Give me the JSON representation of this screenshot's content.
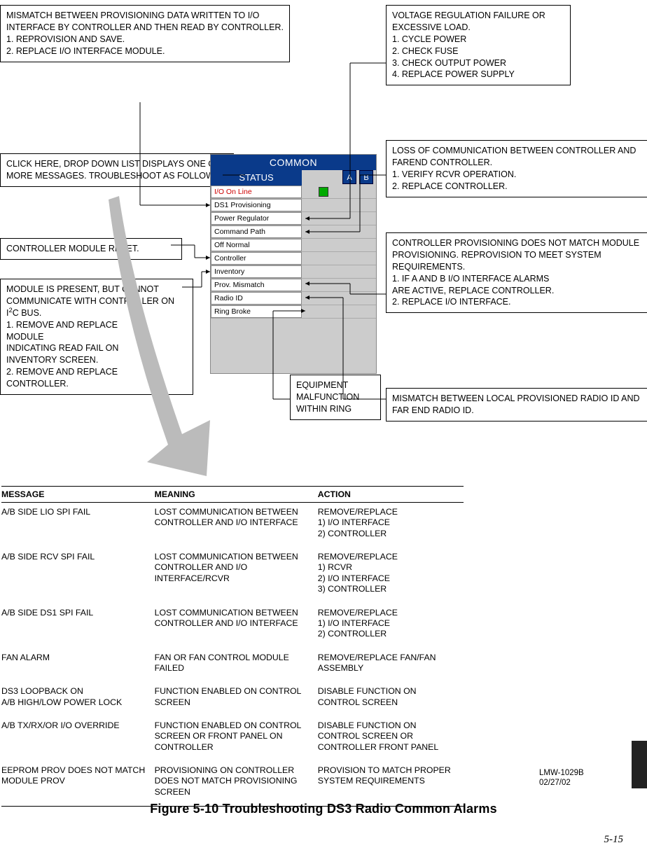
{
  "callouts": {
    "ds1_prov": "MISMATCH BETWEEN PROVISIONING DATA WRITTEN TO I/O INTERFACE BY CONTROLLER AND THEN READ BY CONTROLLER.\n1.  REPROVISION AND SAVE.\n2.  REPLACE I/O INTERFACE MODULE.",
    "voltage": "VOLTAGE REGULATION FAILURE OR EXCESSIVE LOAD.\n1.  CYCLE POWER\n2.  CHECK FUSE\n3.  CHECK OUTPUT POWER\n4.  REPLACE POWER SUPPLY",
    "click_here": "CLICK HERE, DROP DOWN LIST DISPLAYS ONE OR MORE MESSAGES. TROUBLESHOOT AS FOLLOWS.",
    "loss_comm": "LOSS OF COMMUNICATION BETWEEN CONTROLLER AND FAREND CONTROLLER.\n1.  VERIFY RCVR OPERATION.\n2.  REPLACE CONTROLLER.",
    "ctrl_reset": "CONTROLLER MODULE RESET.",
    "prov_mismatch": "CONTROLLER PROVISIONING DOES NOT MATCH MODULE PROVISIONING. REPROVISION TO MEET SYSTEM REQUIREMENTS.\n1.  IF A AND B I/O INTERFACE ALARMS\n     ARE ACTIVE, REPLACE CONTROLLER.\n2.  REPLACE I/O INTERFACE.",
    "module_present_prefix": "MODULE IS PRESENT, BUT CANNOT COMMUNICATE WITH CONTROLLER ON I",
    "module_present_sup": "2",
    "module_present_suffix": "C BUS.\n1.  REMOVE AND REPLACE\n     MODULE\n     INDICATING READ FAIL ON\n     INVENTORY SCREEN.\n2.  REMOVE AND REPLACE\n     CONTROLLER.",
    "ring_broke": "EQUIPMENT MALFUNCTION WITHIN RING",
    "radio_id": "MISMATCH BETWEEN LOCAL PROVISIONED RADIO ID AND FAR END RADIO ID."
  },
  "panel": {
    "common_header": "COMMON",
    "status_label": "STATUS",
    "col_a": "A",
    "col_b": "B",
    "rows": {
      "io_online": "I/O On Line",
      "ds1_prov": "DS1 Provisioning",
      "power_reg": "Power Regulator",
      "cmd_path": "Command Path",
      "off_normal": "Off Normal",
      "controller": "Controller",
      "inventory": "Inventory",
      "prov_mismatch": "Prov. Mismatch",
      "radio_id": "Radio ID",
      "ring_broke": "Ring Broke"
    }
  },
  "table": {
    "headers": {
      "message": "MESSAGE",
      "meaning": "MEANING",
      "action": "ACTION"
    },
    "rows": [
      {
        "message": "A/B SIDE LIO SPI FAIL",
        "meaning": "LOST COMMUNICATION BETWEEN CONTROLLER AND I/O INTERFACE",
        "action": "REMOVE/REPLACE\n1)  I/O INTERFACE\n2)  CONTROLLER"
      },
      {
        "message": "A/B SIDE RCV SPI FAIL",
        "meaning": "LOST COMMUNICATION BETWEEN CONTROLLER AND I/O INTERFACE/RCVR",
        "action": "REMOVE/REPLACE\n1) RCVR\n2)  I/O INTERFACE\n3)  CONTROLLER"
      },
      {
        "message": "A/B SIDE DS1 SPI FAIL",
        "meaning": "LOST COMMUNICATION BETWEEN CONTROLLER AND I/O INTERFACE",
        "action": "REMOVE/REPLACE\n1)  I/O INTERFACE\n2)  CONTROLLER"
      },
      {
        "message": "FAN ALARM",
        "meaning": "FAN OR FAN CONTROL MODULE FAILED",
        "action": "REMOVE/REPLACE FAN/FAN ASSEMBLY"
      },
      {
        "message": "DS3 LOOPBACK ON\nA/B HIGH/LOW POWER LOCK",
        "meaning": "FUNCTION ENABLED ON CONTROL SCREEN",
        "action": "DISABLE FUNCTION ON CONTROL SCREEN"
      },
      {
        "message": "A/B TX/RX/OR I/O OVERRIDE",
        "meaning": "FUNCTION ENABLED ON CONTROL SCREEN OR FRONT PANEL ON CONTROLLER",
        "action": "DISABLE FUNCTION ON CONTROL SCREEN OR CONTROLLER FRONT PANEL"
      },
      {
        "message": "EEPROM PROV DOES NOT MATCH MODULE PROV",
        "meaning": "PROVISIONING ON CONTROLLER DOES NOT MATCH PROVISIONING SCREEN",
        "action": "PROVISION TO MATCH PROPER SYSTEM REQUIREMENTS"
      }
    ]
  },
  "doc_id": {
    "code": "LMW-1029B",
    "date": "02/27/02"
  },
  "caption": "Figure 5-10  Troubleshooting DS3 Radio Common Alarms",
  "page_number": "5-15"
}
